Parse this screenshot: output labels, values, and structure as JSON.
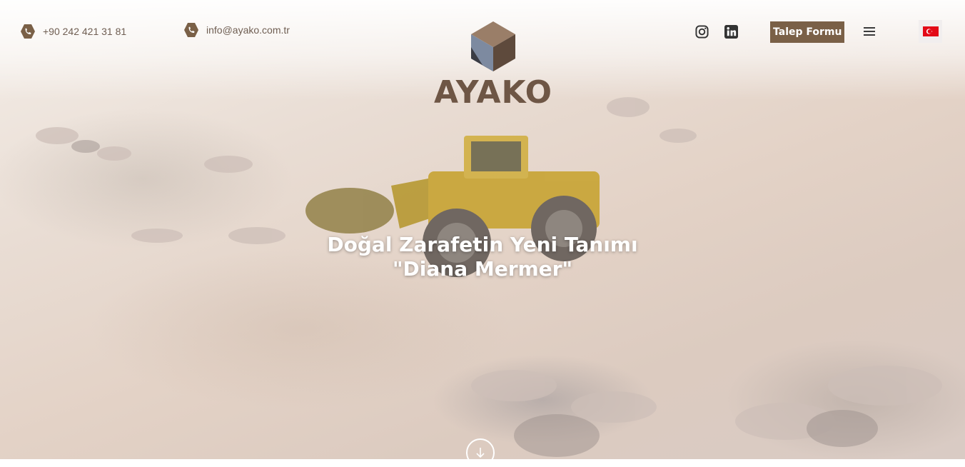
{
  "header": {
    "phone": "+90 242 421 31 81",
    "email": "info@ayako.com.tr",
    "logo_text": "AYAKO",
    "request_button": "Talep Formu",
    "language": "tr"
  },
  "icons": {
    "phone": "phone-icon",
    "email": "phone-icon",
    "instagram": "instagram-icon",
    "linkedin": "linkedin-icon",
    "menu": "hamburger-menu-icon",
    "language_flag": "turkey-flag-icon",
    "scroll": "arrow-down-icon"
  },
  "hero": {
    "title_line1": "Doğal Zarafetin Yeni Tanımı",
    "title_line2": "\"Diana Mermer\""
  },
  "colors": {
    "brand_brown": "#7a6047",
    "contact_text": "#6f5e52",
    "logo_text": "#6e5645"
  }
}
